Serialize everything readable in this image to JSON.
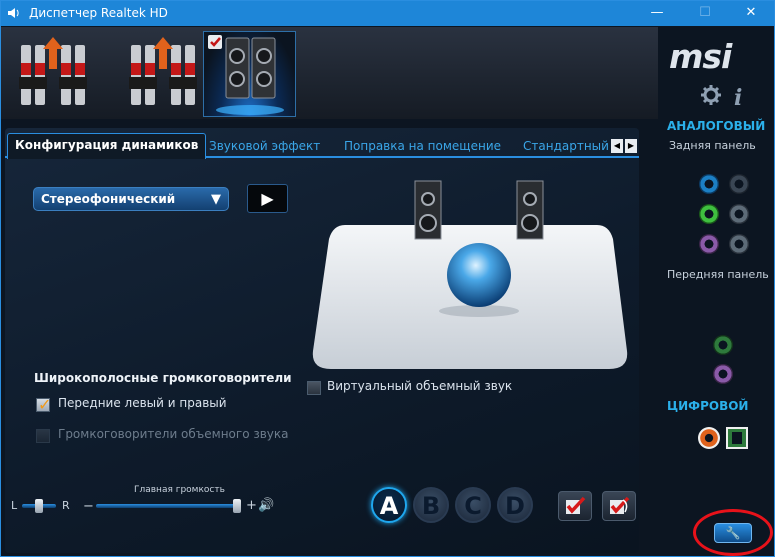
{
  "window": {
    "title": "Диспетчер Realtek HD",
    "minimize": "—",
    "maximize": "☐",
    "close": "✕"
  },
  "brand": {
    "logo": "msi",
    "info_glyph": "i"
  },
  "tabs": [
    {
      "label": "Конфигурация динамиков",
      "active": true
    },
    {
      "label": "Звуковой эффект"
    },
    {
      "label": "Поправка на помещение"
    },
    {
      "label": "Стандартный ф"
    }
  ],
  "tab_nav": {
    "prev": "◀",
    "next": "▶"
  },
  "config": {
    "selected": "Стереофонический",
    "dropdown_arrow": "▼",
    "play": "▶"
  },
  "fullrange": {
    "heading": "Широкополосные громкоговорители",
    "front_label": "Передние левый и правый",
    "front_checked": true,
    "surround_label": "Громкоговорители объемного звука",
    "surround_checked": false
  },
  "virtual_surround": {
    "label": "Виртуальный объемный звук",
    "checked": false
  },
  "volume": {
    "title": "Главная громкость",
    "left": "L",
    "right": "R",
    "minus": "−",
    "plus": "+",
    "speaker_glyph": "🔊",
    "balance": 0.5,
    "level": 1.0
  },
  "profiles": [
    "A",
    "B",
    "C",
    "D"
  ],
  "active_profile": "A",
  "sidebar": {
    "analog_heading": "АНАЛОГОВЫЙ",
    "rear_panel": "Задняя панель",
    "front_panel": "Передняя панель",
    "digital_heading": "ЦИФРОВОЙ"
  },
  "wrench_glyph": "🔧",
  "colors": {
    "accent": "#2a8ee0",
    "tab_text": "#3aa6e8",
    "titlebar": "#1e86d8",
    "jack_blue": "#1c7fc4",
    "jack_green": "#3fbf3f",
    "jack_pink": "#b06ad0",
    "jack_grey": "#5d6b78",
    "highlight": "#e8121a"
  }
}
